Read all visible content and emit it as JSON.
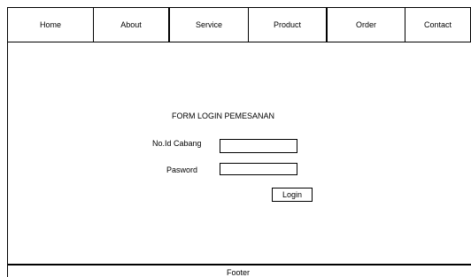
{
  "nav": {
    "items": [
      {
        "label": "Home"
      },
      {
        "label": "About"
      },
      {
        "label": "Service"
      },
      {
        "label": "Product"
      },
      {
        "label": "Order"
      },
      {
        "label": "Contact"
      }
    ]
  },
  "form": {
    "title": "FORM LOGIN PEMESANAN",
    "id_label": "No.Id Cabang",
    "id_value": "",
    "password_label": "Pasword",
    "password_value": "",
    "login_label": "Login"
  },
  "footer": {
    "text": "Footer"
  }
}
